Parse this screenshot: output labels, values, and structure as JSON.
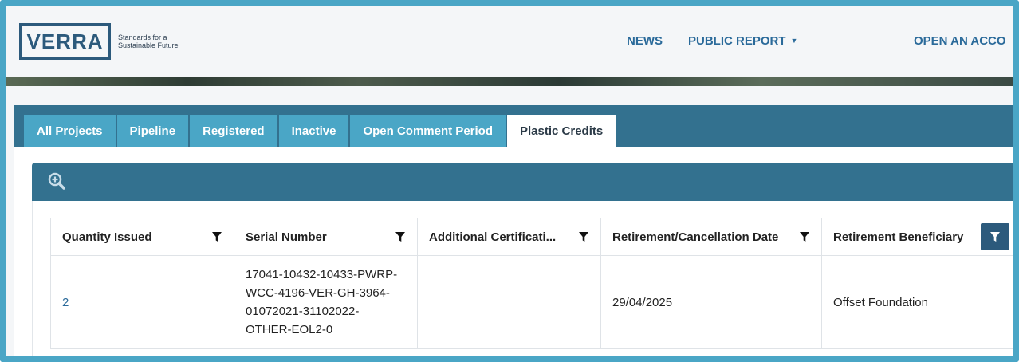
{
  "header": {
    "logo_text": "VERRA",
    "tagline": "Standards for a Sustainable Future",
    "nav": {
      "news": "NEWS",
      "public_report": "PUBLIC REPORT",
      "open_account": "OPEN AN ACCO"
    }
  },
  "tabs": [
    {
      "label": "All Projects",
      "active": false
    },
    {
      "label": "Pipeline",
      "active": false
    },
    {
      "label": "Registered",
      "active": false
    },
    {
      "label": "Inactive",
      "active": false
    },
    {
      "label": "Open Comment Period",
      "active": false
    },
    {
      "label": "Plastic Credits",
      "active": true
    }
  ],
  "toolbar": {
    "icon": "zoom-in-icon"
  },
  "table": {
    "columns": [
      "Quantity Issued",
      "Serial Number",
      "Additional Certificati...",
      "Retirement/Cancellation Date",
      "Retirement Beneficiary"
    ],
    "rows": [
      {
        "quantity": "2",
        "serial_lines": [
          "17041-10432-10433-PWRP-",
          "WCC-4196-VER-GH-3964-",
          "01072021-31102022-",
          "OTHER-EOL2-0"
        ],
        "additional": "",
        "date": "29/04/2025",
        "beneficiary": "Offset Foundation"
      }
    ]
  },
  "colors": {
    "frame": "#4aa6c6",
    "tab_band": "#33718f",
    "tab": "#4aa6c6",
    "brand": "#2c5a7c",
    "link": "#2a6a9a"
  }
}
